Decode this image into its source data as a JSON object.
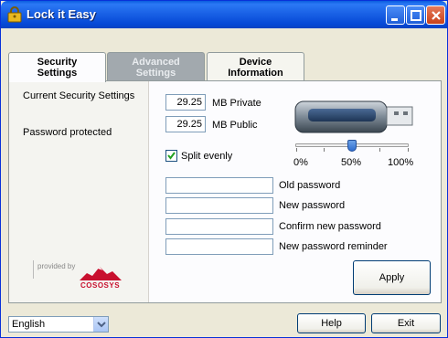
{
  "window": {
    "title": "Lock it Easy"
  },
  "tabs": [
    {
      "line1": "Security",
      "line2": "Settings"
    },
    {
      "line1": "Advanced",
      "line2": "Settings"
    },
    {
      "line1": "Device",
      "line2": "Information"
    }
  ],
  "status": {
    "current_settings_label": "Current Security Settings",
    "password_protected_label": "Password protected"
  },
  "provider": {
    "provided_by": "provided by",
    "brand": "COSOSYS"
  },
  "partition": {
    "private_value": "29.25",
    "private_unit": "MB Private",
    "public_value": "29.25",
    "public_unit": "MB Public",
    "split_evenly_label": "Split evenly",
    "split_evenly_checked": true
  },
  "slider": {
    "min_label": "0%",
    "mid_label": "50%",
    "max_label": "100%",
    "value_percent": 50
  },
  "password_fields": {
    "old_label": "Old password",
    "new_label": "New password",
    "confirm_label": "Confirm new password",
    "reminder_label": "New password reminder"
  },
  "buttons": {
    "apply": "Apply",
    "help": "Help",
    "exit": "Exit"
  },
  "language": {
    "selected": "English"
  },
  "colors": {
    "titlebar": "#0a5ddf",
    "window_bg": "#ece9d8",
    "brand_red": "#c8102e"
  }
}
